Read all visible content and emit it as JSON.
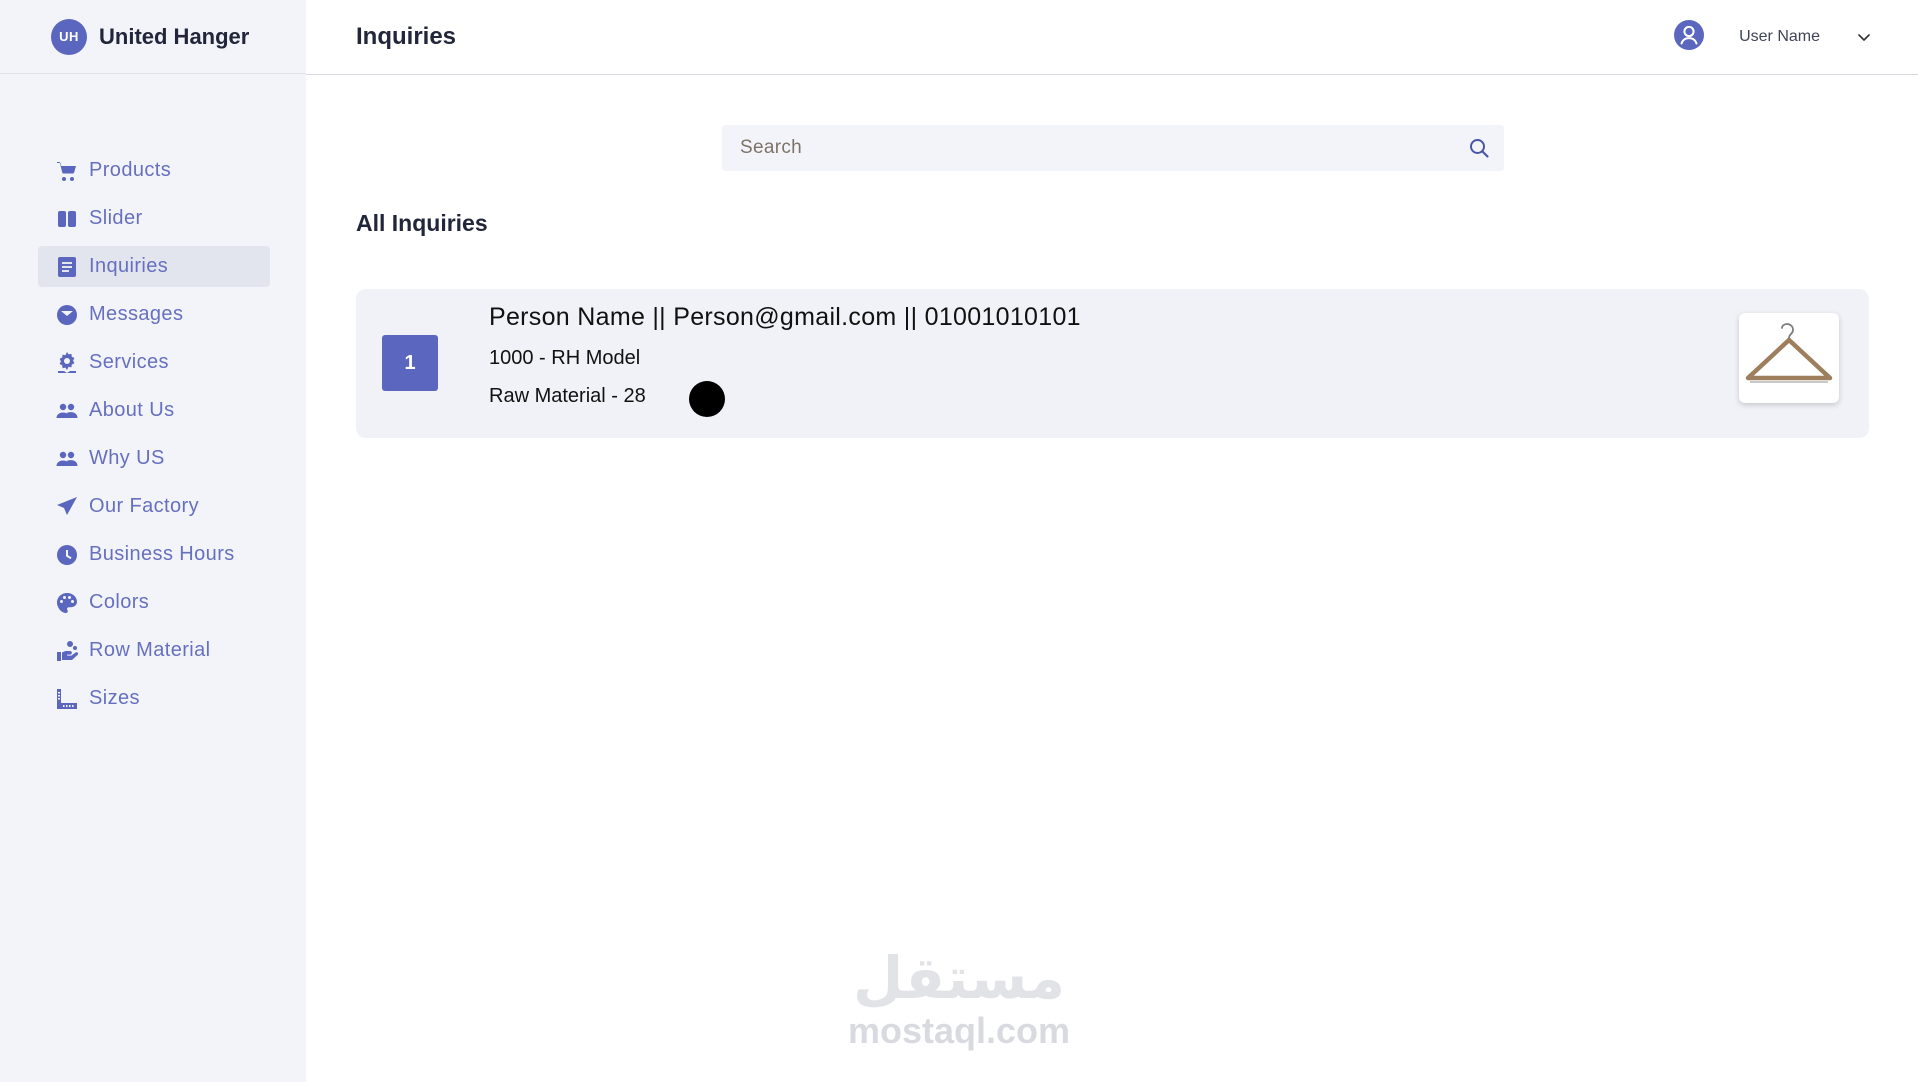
{
  "brand": {
    "badge": "UH",
    "name": "United Hanger"
  },
  "sidebar": {
    "items": [
      {
        "label": "Products",
        "icon": "cart-icon"
      },
      {
        "label": "Slider",
        "icon": "slider-icon"
      },
      {
        "label": "Inquiries",
        "icon": "inquiries-icon",
        "active": true
      },
      {
        "label": "Messages",
        "icon": "messages-icon"
      },
      {
        "label": "Services",
        "icon": "services-icon"
      },
      {
        "label": "About Us",
        "icon": "users-icon"
      },
      {
        "label": "Why US",
        "icon": "users-icon"
      },
      {
        "label": "Our Factory",
        "icon": "paper-plane-icon"
      },
      {
        "label": "Business Hours",
        "icon": "clock-icon"
      },
      {
        "label": "Colors",
        "icon": "palette-icon"
      },
      {
        "label": "Row Material",
        "icon": "hand-coins-icon"
      },
      {
        "label": "Sizes",
        "icon": "ruler-icon"
      }
    ]
  },
  "header": {
    "title": "Inquiries",
    "user_name": "User Name"
  },
  "search": {
    "placeholder": "Search",
    "value": ""
  },
  "main": {
    "section_title": "All Inquiries",
    "inquiries": [
      {
        "index": "1",
        "contact": "Person Name  ||  Person@gmail.com  ||  01001010101",
        "model": "1000 - RH Model",
        "material": "Raw Material - 28",
        "color": "#000000"
      }
    ]
  },
  "watermark": {
    "arabic": "مستقل",
    "latin": "mostaql.com"
  },
  "colors": {
    "accent": "#5b66bf",
    "sidebar_bg": "#f3f4fa",
    "card_bg": "#f1f2f8"
  }
}
